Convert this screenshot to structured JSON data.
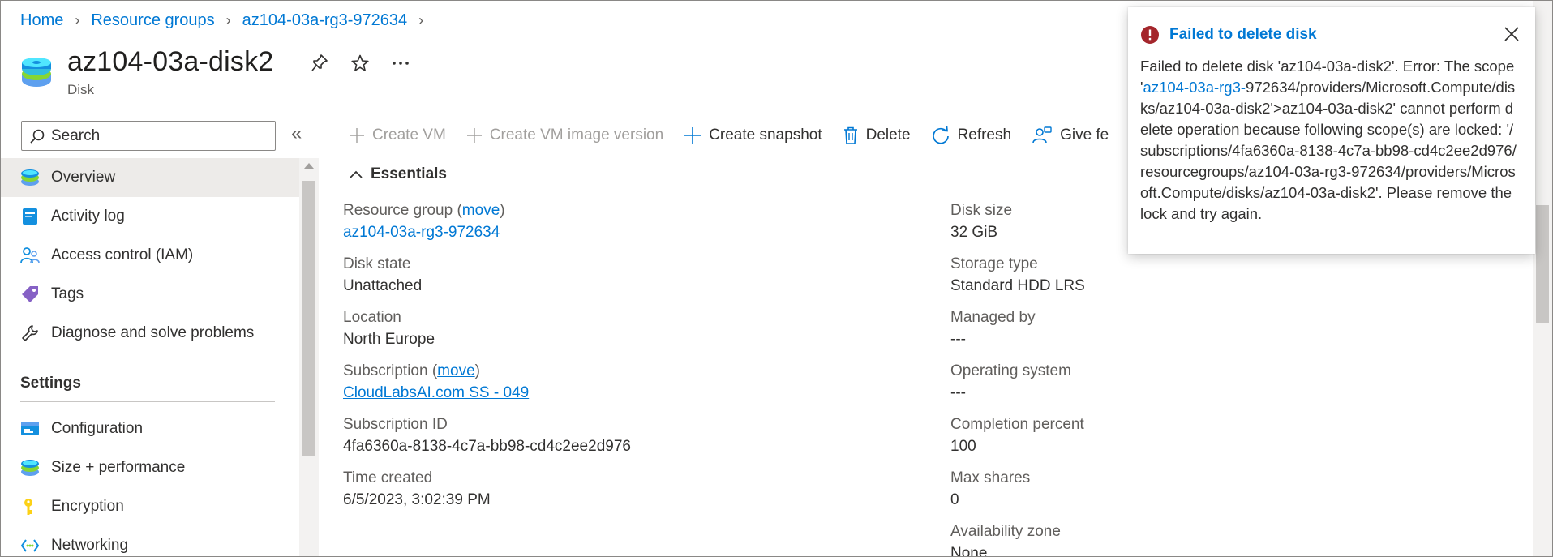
{
  "breadcrumb": {
    "items": [
      "Home",
      "Resource groups",
      "az104-03a-rg3-972634"
    ]
  },
  "resource": {
    "name": "az104-03a-disk2",
    "type": "Disk"
  },
  "search": {
    "placeholder": "Search"
  },
  "sidebar": {
    "items": [
      {
        "label": "Overview",
        "icon": "disk-icon"
      },
      {
        "label": "Activity log",
        "icon": "activity-log-icon"
      },
      {
        "label": "Access control (IAM)",
        "icon": "iam-icon"
      },
      {
        "label": "Tags",
        "icon": "tag-icon"
      },
      {
        "label": "Diagnose and solve problems",
        "icon": "wrench-icon"
      }
    ],
    "settings_heading": "Settings",
    "settings_items": [
      {
        "label": "Configuration",
        "icon": "configuration-icon"
      },
      {
        "label": "Size + performance",
        "icon": "disk-icon"
      },
      {
        "label": "Encryption",
        "icon": "key-icon"
      },
      {
        "label": "Networking",
        "icon": "networking-icon"
      }
    ]
  },
  "commands": {
    "create_vm": "Create VM",
    "create_vm_image": "Create VM image version",
    "create_snapshot": "Create snapshot",
    "delete": "Delete",
    "refresh": "Refresh",
    "give_feedback": "Give fe"
  },
  "essentials": {
    "heading": "Essentials",
    "move": "move",
    "resource_group_label": "Resource group (",
    "resource_group_close": ")",
    "resource_group": "az104-03a-rg3-972634",
    "disk_state_label": "Disk state",
    "disk_state": "Unattached",
    "location_label": "Location",
    "location": "North Europe",
    "subscription_label": "Subscription (",
    "subscription_close": ")",
    "subscription": "CloudLabsAI.com SS - 049",
    "subscription_id_label": "Subscription ID",
    "subscription_id": "4fa6360a-8138-4c7a-bb98-cd4c2ee2d976",
    "time_created_label": "Time created",
    "time_created": "6/5/2023, 3:02:39 PM",
    "disk_size_label": "Disk size",
    "disk_size": "32 GiB",
    "storage_type_label": "Storage type",
    "storage_type": "Standard HDD LRS",
    "managed_by_label": "Managed by",
    "managed_by": "---",
    "os_label": "Operating system",
    "os": "---",
    "completion_label": "Completion percent",
    "completion": "100",
    "max_shares_label": "Max shares",
    "max_shares": "0",
    "availability_zone_label": "Availability zone",
    "availability_zone": "None"
  },
  "notification": {
    "title": "Failed to delete disk",
    "body_pre": "Failed to delete disk 'az104-03a-disk2'. Error: The scope '",
    "body_link": "az104-03a-rg3-",
    "body_post": "972634/providers/Microsoft.Compute/disks/az104-03a-disk2'>az104-03a-disk2' cannot perform delete operation because following scope(s) are locked: '/subscriptions/4fa6360a-8138-4c7a-bb98-cd4c2ee2d976/resourcegroups/az104-03a-rg3-972634/providers/Microsoft.Compute/disks/az104-03a-disk2'. Please remove the lock and try again."
  },
  "colors": {
    "accent": "#0078d4",
    "error": "#a4262c",
    "selected_bg": "#edebe9"
  }
}
